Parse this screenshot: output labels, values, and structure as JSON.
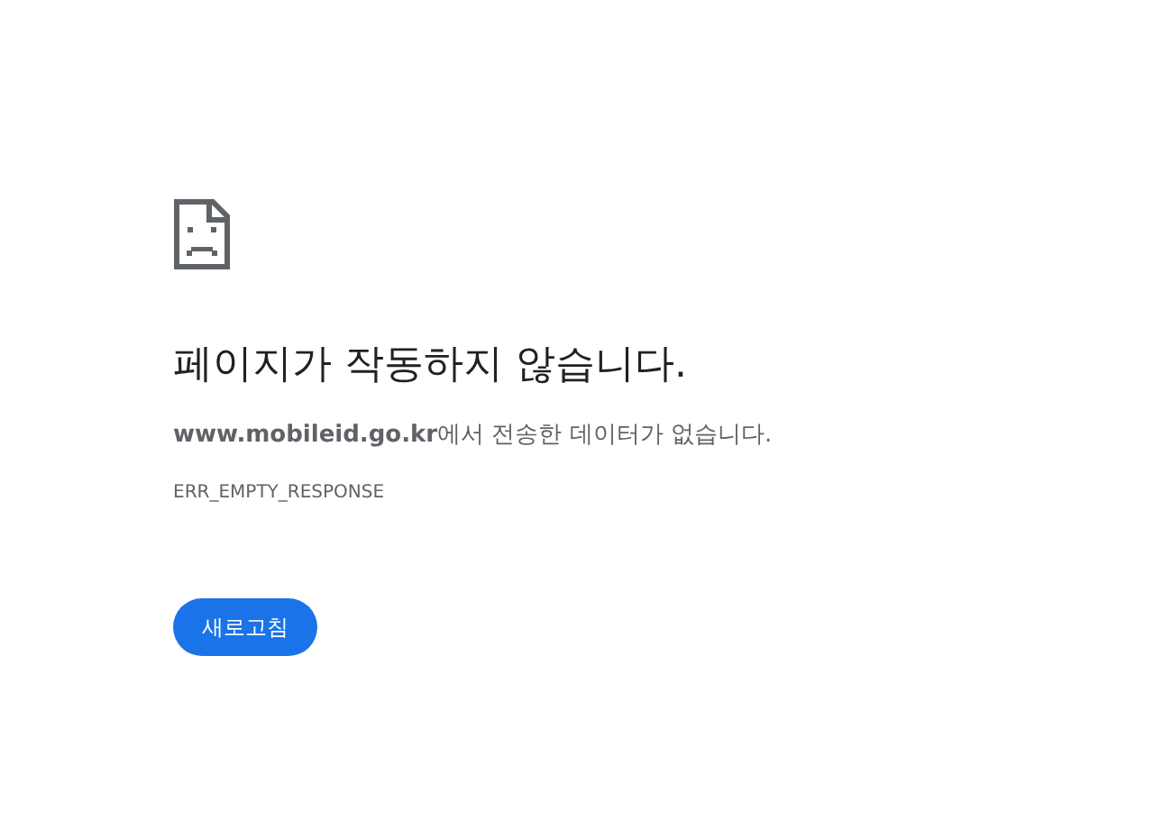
{
  "heading": "페이지가 작동하지 않습니다.",
  "message": "**www.mobileid.go.kr**에서 전송한 데이터가 없습니다.",
  "error_code": "ERR_EMPTY_RESPONSE",
  "buttons": [
    {
      "label": "새로고침",
      "kind": "primary"
    }
  ]
}
